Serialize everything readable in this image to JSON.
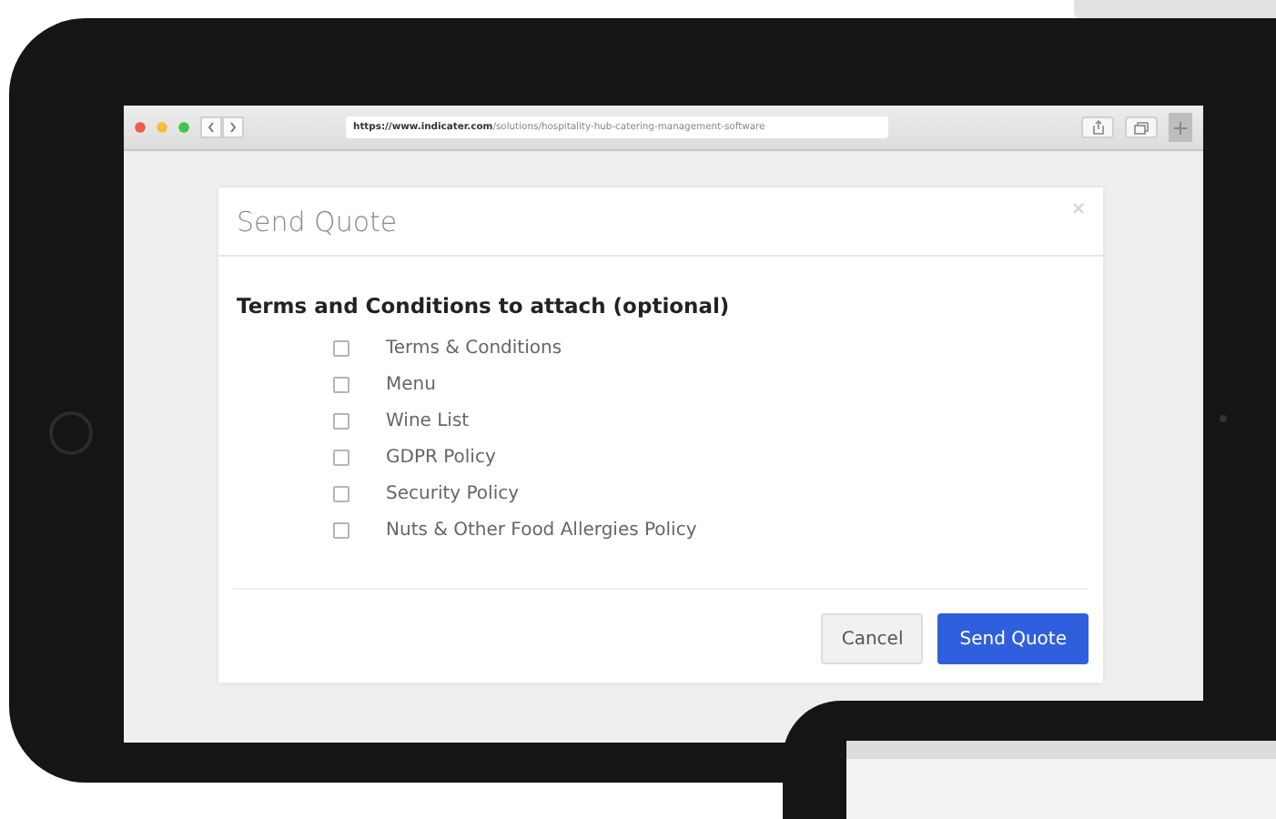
{
  "browser": {
    "url": "**https://www.indicater.com**/solutions/hospitality-hub-catering-management-software"
  },
  "modal": {
    "title": "Send Quote",
    "heading": "Terms and Conditions to attach (optional)",
    "options": [
      {
        "label": "Terms & Conditions",
        "checked": false
      },
      {
        "label": "Menu",
        "checked": false
      },
      {
        "label": "Wine List",
        "checked": false
      },
      {
        "label": "GDPR Policy",
        "checked": false
      },
      {
        "label": "Security Policy",
        "checked": false
      },
      {
        "label": "Nuts & Other Food Allergies Policy",
        "checked": false
      }
    ],
    "buttons": [
      {
        "label": "Cancel",
        "kind": "secondary"
      },
      {
        "label": "Send Quote",
        "kind": "primary"
      }
    ]
  }
}
